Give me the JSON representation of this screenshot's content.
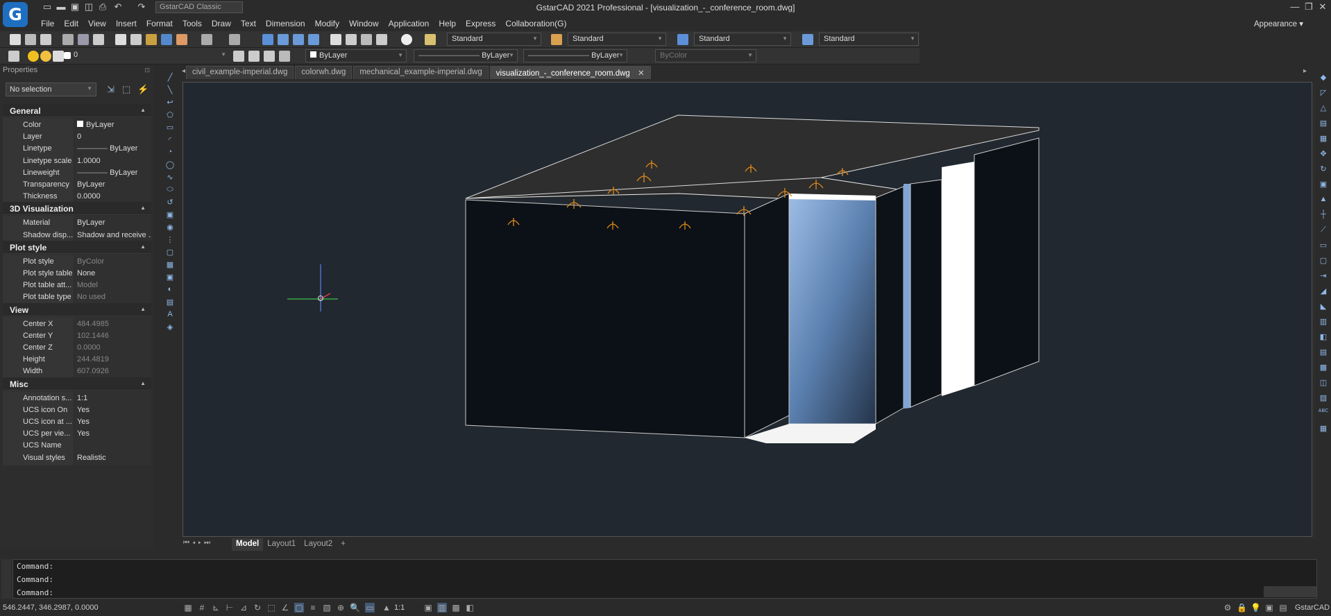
{
  "title": {
    "app": "GstarCAD 2021 Professional - [visualization_-_conference_room.dwg]",
    "workspace": "GstarCAD Classic",
    "logo": "G"
  },
  "menus": [
    "File",
    "Edit",
    "View",
    "Insert",
    "Format",
    "Tools",
    "Draw",
    "Text",
    "Dimension",
    "Modify",
    "Window",
    "Application",
    "Help",
    "Express",
    "Collaboration(G)"
  ],
  "appearance": "Appearance",
  "toolbar": {
    "textstyle": "Standard",
    "dimstyle": "Standard",
    "tablestyle": "Standard",
    "mleaderstyle": "Standard",
    "layer": "0",
    "color": "ByLayer",
    "linetype": "ByLayer",
    "lineweight": "ByLayer",
    "plotstyle": "ByColor"
  },
  "properties": {
    "header": "Properties",
    "selection": "No selection",
    "sections": [
      {
        "name": "General",
        "rows": [
          [
            "Color",
            "ByLayer"
          ],
          [
            "Layer",
            "0"
          ],
          [
            "Linetype",
            "ByLayer"
          ],
          [
            "Linetype scale",
            "1.0000"
          ],
          [
            "Lineweight",
            "ByLayer"
          ],
          [
            "Transparency",
            "ByLayer"
          ],
          [
            "Thickness",
            "0.0000"
          ]
        ]
      },
      {
        "name": "3D Visualization",
        "rows": [
          [
            "Material",
            "ByLayer"
          ],
          [
            "Shadow disp...",
            "Shadow and receive ..."
          ]
        ]
      },
      {
        "name": "Plot style",
        "rows": [
          [
            "Plot style",
            "ByColor"
          ],
          [
            "Plot style table",
            "None"
          ],
          [
            "Plot table att...",
            "Model"
          ],
          [
            "Plot table type",
            "No used"
          ]
        ]
      },
      {
        "name": "View",
        "rows": [
          [
            "Center X",
            "484.4985"
          ],
          [
            "Center Y",
            "102.1446"
          ],
          [
            "Center Z",
            "0.0000"
          ],
          [
            "Height",
            "244.4819"
          ],
          [
            "Width",
            "607.0926"
          ]
        ]
      },
      {
        "name": "Misc",
        "rows": [
          [
            "Annotation s...",
            "1:1"
          ],
          [
            "UCS icon On",
            "Yes"
          ],
          [
            "UCS icon at ...",
            "Yes"
          ],
          [
            "UCS per vie...",
            "Yes"
          ],
          [
            "UCS Name",
            ""
          ],
          [
            "Visual styles",
            "Realistic"
          ]
        ]
      }
    ]
  },
  "file_tabs": [
    "civil_example-imperial.dwg",
    "colorwh.dwg",
    "mechanical_example-imperial.dwg",
    "visualization_-_conference_room.dwg"
  ],
  "layout_tabs": [
    "Model",
    "Layout1",
    "Layout2",
    "+"
  ],
  "command": {
    "lines": [
      "Command:",
      "Command:",
      "Command:"
    ]
  },
  "status": {
    "coords": "546.2447, 346.2987, 0.0000",
    "scale": "1:1",
    "app": "GstarCAD"
  }
}
